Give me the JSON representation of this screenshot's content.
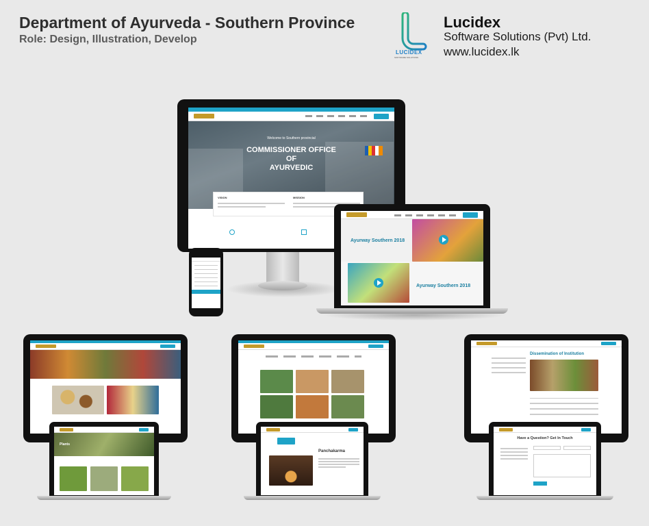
{
  "header": {
    "title": "Department of Ayurveda - Southern Province",
    "role": "Role: Design, Illustration, Develop"
  },
  "brand": {
    "logo_text": "LUCIDEX",
    "logo_tagline": "SOFTWARE SOLUTIONS",
    "name": "Lucidex",
    "subtitle": "Software Solutions (Pvt) Ltd.",
    "url": "www.lucidex.lk"
  },
  "imac": {
    "hero_small": "Welcome to Southern provincial",
    "hero_line1": "COMMISSIONER OFFICE",
    "hero_line2": "OF",
    "hero_line3": "AYURVEDIC",
    "card1_title": "VISION",
    "card2_title": "MISSION"
  },
  "macbook_main": {
    "item1_label": "Ayurway Southern 2018",
    "item2_label": "Ayurway Southern 2018"
  },
  "laptop_left": {
    "section_label": "Plants"
  },
  "laptop_middle": {
    "heading": "Panchakarma"
  },
  "monitor_right": {
    "heading": "Dissemination of Institution"
  },
  "laptop_right": {
    "heading": "Have a Question? Get In Touch"
  },
  "colors": {
    "accent": "#1ea3c7",
    "text_dark": "#2e2e2e",
    "brand_green": "#2fb67a",
    "brand_blue": "#1e7fc6",
    "background": "#e9e9e9"
  }
}
